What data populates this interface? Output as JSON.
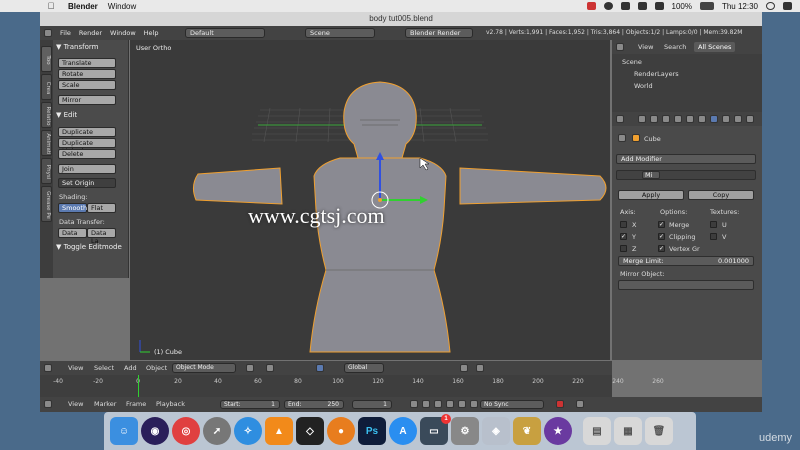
{
  "macbar": {
    "app_name": "Blender",
    "menu": [
      "Window"
    ],
    "battery": "100%",
    "clock": "Thu 12:30",
    "icons": [
      "apple-icon",
      "flag-icon",
      "record-icon",
      "dropbox-icon",
      "wifi-icon",
      "volume-icon",
      "search-icon",
      "list-icon"
    ]
  },
  "window": {
    "title": "body tut005.blend"
  },
  "info_header": {
    "menus": [
      "File",
      "Render",
      "Window",
      "Help"
    ],
    "layout": "Default",
    "scene": "Scene",
    "engine": "Blender Render",
    "stats": "v2.78 | Verts:1,991 | Faces:1,952 | Tris:3,864 | Objects:1/2 | Lamps:0/0 | Mem:39.82M"
  },
  "tabs": [
    "Too",
    "Crea",
    "Relatio",
    "Animati",
    "Physi",
    "Grease Pe"
  ],
  "toolshelf": {
    "transform_title": "Transform",
    "transform": [
      "Translate",
      "Rotate",
      "Scale"
    ],
    "mirror": "Mirror",
    "edit_title": "Edit",
    "edit": [
      "Duplicate",
      "Duplicate Linked",
      "Delete"
    ],
    "join": "Join",
    "set_origin": "Set Origin",
    "shading_label": "Shading:",
    "smooth": "Smooth",
    "flat": "Flat",
    "data_transfer_label": "Data Transfer:",
    "data": "Data",
    "data_la": "Data La",
    "toggle": "Toggle Editmode"
  },
  "viewport": {
    "title": "User Ortho",
    "object": "(1) Cube",
    "watermark": "www.cgtsj.com"
  },
  "outliner": {
    "tabs": [
      "View",
      "Search",
      "All Scenes"
    ],
    "rows": [
      "Scene",
      "RenderLayers",
      "World"
    ]
  },
  "properties": {
    "object": "Cube",
    "add_modifier": "Add Modifier",
    "modifier_name": "Mi",
    "apply": "Apply",
    "copy": "Copy",
    "axis_label": "Axis:",
    "options_label": "Options:",
    "textures_label": "Textures:",
    "axes": [
      {
        "label": "X",
        "checked": false
      },
      {
        "label": "Y",
        "checked": true
      },
      {
        "label": "Z",
        "checked": false
      }
    ],
    "options": [
      {
        "label": "Merge",
        "checked": true
      },
      {
        "label": "Clipping",
        "checked": true
      },
      {
        "label": "Vertex Gr",
        "checked": true
      }
    ],
    "textures": [
      "U",
      "V"
    ],
    "merge_limit_label": "Merge Limit:",
    "merge_limit_value": "0.001000",
    "mirror_object_label": "Mirror Object:"
  },
  "view3d_header": {
    "menus": [
      "View",
      "Select",
      "Add",
      "Object"
    ],
    "mode": "Object Mode",
    "pivot": "Global"
  },
  "timeline": {
    "ticks": [
      "-40",
      "-20",
      "0",
      "20",
      "40",
      "60",
      "80",
      "100",
      "120",
      "140",
      "160",
      "180",
      "200",
      "220",
      "240",
      "260"
    ],
    "current_frame": 0
  },
  "timeline_header": {
    "menus": [
      "View",
      "Marker",
      "Frame",
      "Playback"
    ],
    "start_label": "Start:",
    "start": "1",
    "end_label": "End:",
    "end": "250",
    "frame": "1",
    "sync": "No Sync"
  },
  "dock": {
    "items": [
      "finder",
      "siri",
      "chrome",
      "launchpad",
      "safari",
      "vlc",
      "unity",
      "blender",
      "photoshop",
      "app-store",
      "screen-share",
      "system-prefs",
      "game-center",
      "pineapple",
      "imovie",
      "preview",
      "trash"
    ],
    "badge": "1"
  },
  "watermark": "udemy",
  "colors": {
    "selection_orange": "#f0a030",
    "axis_x": "#e04040",
    "axis_y": "#30d030",
    "axis_z": "#3050e0",
    "mesh": "#8a8a92"
  }
}
